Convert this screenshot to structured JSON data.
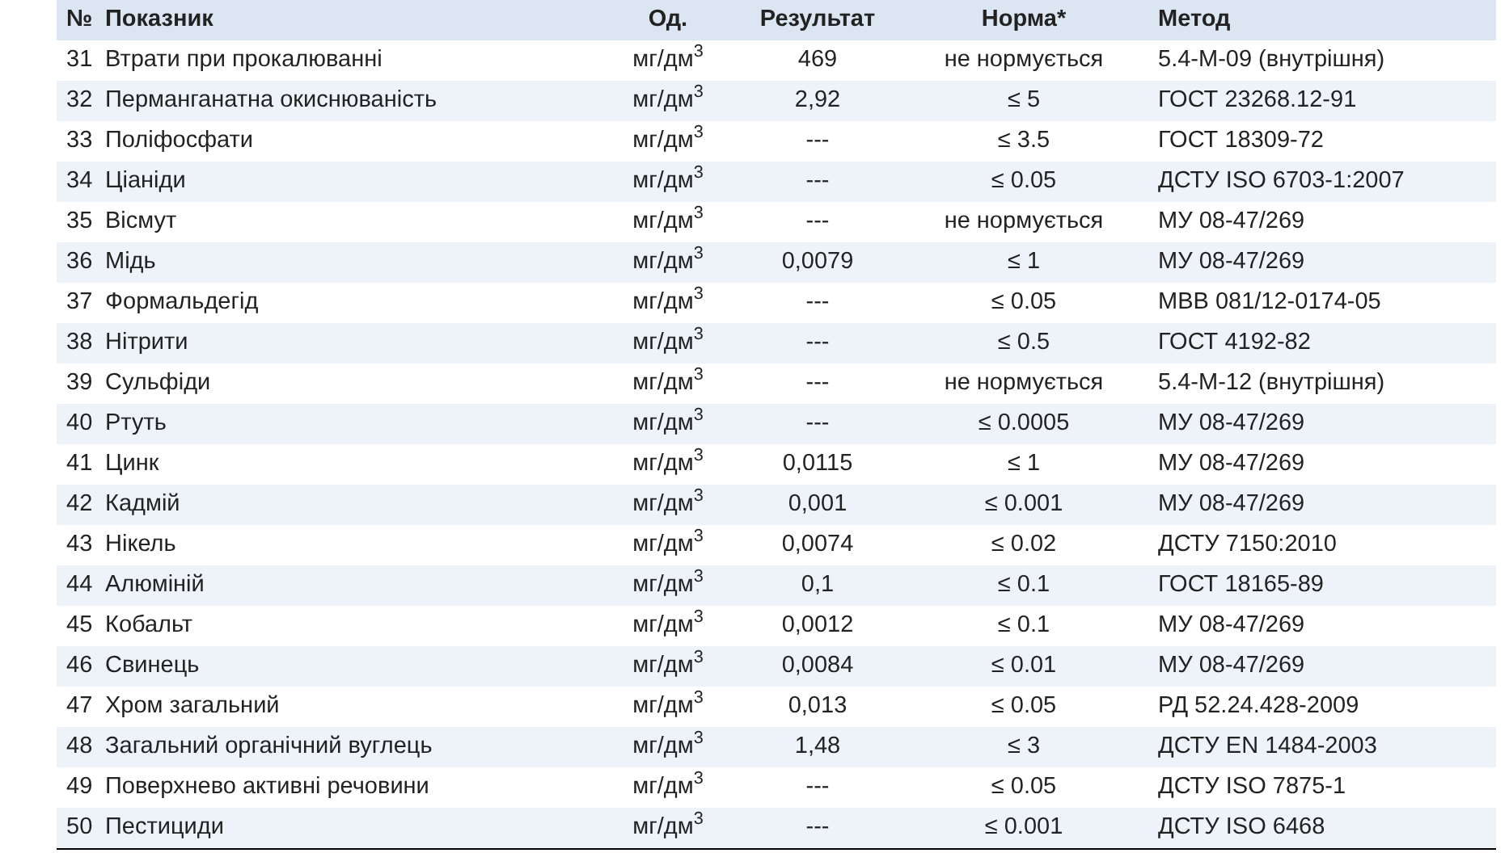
{
  "table": {
    "columns": [
      "№",
      "Показник",
      "Од.",
      "Результат",
      "Норма*",
      "Метод"
    ],
    "rows": [
      [
        "31",
        "Втрати при прокалюванні",
        "мг/дм$^{3}$",
        "469",
        "не нормується",
        "5.4-М-09 (внутрішня)"
      ],
      [
        "32",
        "Перманганатна окиснюваність",
        "мг/дм$^{3}$",
        "2,92",
        "≤ 5",
        "ГОСТ 23268.12-91"
      ],
      [
        "33",
        "Поліфосфати",
        "мг/дм$^{3}$",
        "---",
        "≤ 3.5",
        "ГОСТ 18309-72"
      ],
      [
        "34",
        "Ціаніди",
        "мг/дм$^{3}$",
        "---",
        "≤ 0.05",
        "ДСТУ ISO 6703-1:2007"
      ],
      [
        "35",
        "Вісмут",
        "мг/дм$^{3}$",
        "---",
        "не нормується",
        "МУ 08-47/269"
      ],
      [
        "36",
        "Мідь",
        "мг/дм$^{3}$",
        "0,0079",
        "≤ 1",
        "МУ 08-47/269"
      ],
      [
        "37",
        "Формальдегід",
        "мг/дм$^{3}$",
        "---",
        "≤ 0.05",
        "МВВ 081/12-0174-05"
      ],
      [
        "38",
        "Нітрити",
        "мг/дм$^{3}$",
        "---",
        "≤ 0.5",
        "ГОСТ 4192-82"
      ],
      [
        "39",
        "Сульфіди",
        "мг/дм$^{3}$",
        "---",
        "не нормується",
        "5.4-М-12 (внутрішня)"
      ],
      [
        "40",
        "Ртуть",
        "мг/дм$^{3}$",
        "---",
        "≤ 0.0005",
        "МУ 08-47/269"
      ],
      [
        "41",
        "Цинк",
        "мг/дм$^{3}$",
        "0,0115",
        "≤ 1",
        "МУ 08-47/269"
      ],
      [
        "42",
        "Кадмій",
        "мг/дм$^{3}$",
        "0,001",
        "≤ 0.001",
        "МУ 08-47/269"
      ],
      [
        "43",
        "Нікель",
        "мг/дм$^{3}$",
        "0,0074",
        "≤ 0.02",
        "ДСТУ 7150:2010"
      ],
      [
        "44",
        "Алюміній",
        "мг/дм$^{3}$",
        "0,1",
        "≤ 0.1",
        "ГОСТ 18165-89"
      ],
      [
        "45",
        "Кобальт",
        "мг/дм$^{3}$",
        "0,0012",
        "≤ 0.1",
        "МУ 08-47/269"
      ],
      [
        "46",
        "Свинець",
        "мг/дм$^{3}$",
        "0,0084",
        "≤ 0.01",
        "МУ 08-47/269"
      ],
      [
        "47",
        "Хром загальний",
        "мг/дм$^{3}$",
        "0,013",
        "≤ 0.05",
        "РД 52.24.428-2009"
      ],
      [
        "48",
        "Загальний органічний вуглець",
        "мг/дм$^{3}$",
        "1,48",
        "≤ 3",
        "ДСТУ EN 1484-2003"
      ],
      [
        "49",
        "Поверхнево активні речовини",
        "мг/дм$^{3}$",
        "---",
        "≤ 0.05",
        "ДСТУ ISO 7875-1"
      ],
      [
        "50",
        "Пестициди",
        "мг/дм$^{3}$",
        "---",
        "≤ 0.001",
        "ДСТУ ISO 6468"
      ]
    ]
  }
}
